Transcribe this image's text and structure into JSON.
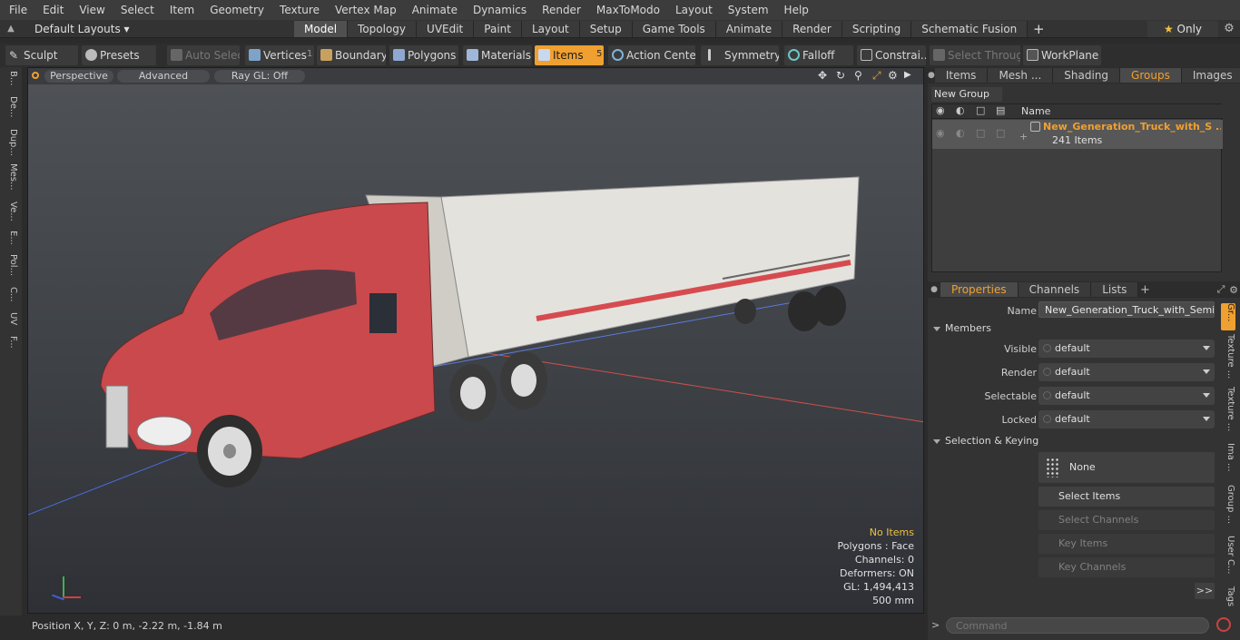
{
  "menu": [
    "File",
    "Edit",
    "View",
    "Select",
    "Item",
    "Geometry",
    "Texture",
    "Vertex Map",
    "Animate",
    "Dynamics",
    "Render",
    "MaxToModo",
    "Layout",
    "System",
    "Help"
  ],
  "layout_selector": "Default Layouts",
  "mode_tabs": [
    "Model",
    "Topology",
    "UVEdit",
    "Paint",
    "Layout",
    "Setup",
    "Game Tools",
    "Animate",
    "Render",
    "Scripting",
    "Schematic Fusion"
  ],
  "active_mode_tab": "Model",
  "only_label": "Only",
  "toolbar": {
    "sculpt": "Sculpt",
    "presets": "Presets",
    "auto_select": "Auto Select",
    "vertices": "Vertices",
    "vertices_count": "1",
    "boundary": "Boundary",
    "polygons": "Polygons",
    "materials": "Materials",
    "items": "Items",
    "items_count": "5",
    "action_center": "Action Center",
    "symmetry": "Symmetry",
    "falloff": "Falloff",
    "constraints": "Constrai...",
    "select_through": "Select Through",
    "workplane": "WorkPlane"
  },
  "left_tabs": [
    "B...",
    "De...",
    "Dup...",
    "Mes...",
    "Ve...",
    "E...",
    "Pol...",
    "C...",
    "UV",
    "F..."
  ],
  "viewport": {
    "perspective": "Perspective",
    "advanced": "Advanced",
    "raygl": "Ray GL: Off",
    "info": {
      "no_items": "No Items",
      "polygons": "Polygons : Face",
      "channels": "Channels: 0",
      "deformers": "Deformers: ON",
      "gl": "GL: 1,494,413",
      "scale": "500 mm"
    }
  },
  "status": {
    "position": "Position X, Y, Z:  0 m, -2.22 m, -1.84 m"
  },
  "groups_panel": {
    "tabs": [
      "Items",
      "Mesh ...",
      "Shading",
      "Groups",
      "Images"
    ],
    "active_tab": "Groups",
    "new_group": "New Group",
    "name_col": "Name",
    "group_name": "New_Generation_Truck_with_S ...",
    "group_count": "241 Items"
  },
  "properties_panel": {
    "tabs": [
      "Properties",
      "Channels",
      "Lists"
    ],
    "active_tab": "Properties",
    "name_label": "Name",
    "name_value": "New_Generation_Truck_with_Semi_Tr",
    "members_head": "Members",
    "visible_label": "Visible",
    "visible_value": "default",
    "render_label": "Render",
    "render_value": "default",
    "selectable_label": "Selectable",
    "selectable_value": "default",
    "locked_label": "Locked",
    "locked_value": "default",
    "selection_head": "Selection & Keying",
    "none_btn": "None",
    "select_items": "Select Items",
    "select_channels": "Select Channels",
    "key_items": "Key Items",
    "key_channels": "Key Channels",
    "more": ">>"
  },
  "right_tabs": [
    "Gr...",
    "Texture ...",
    "Texture ...",
    "Ima ...",
    "Group ...",
    "User C...",
    "Tags"
  ],
  "command_placeholder": "Command",
  "colors": {
    "accent": "#f0a030",
    "truck_red": "#c9494c",
    "trailer_white": "#e4e2dc"
  }
}
